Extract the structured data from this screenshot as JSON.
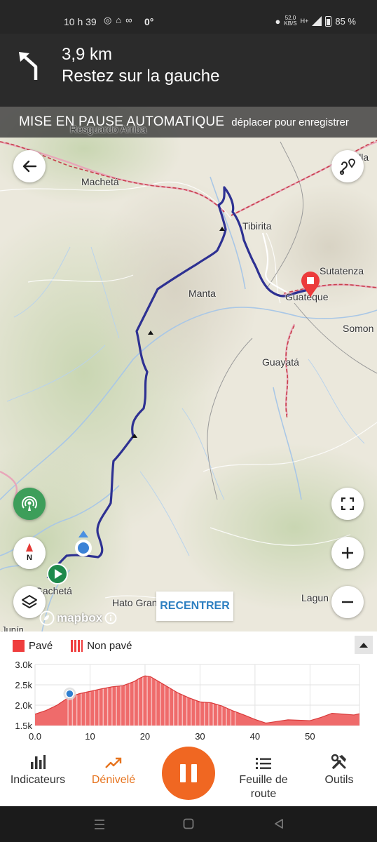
{
  "status_bar": {
    "time": "10 h 39",
    "temperature": "0°",
    "network_speed": "52,0",
    "network_unit": "KB/S",
    "network_type": "H+",
    "battery": "85 %"
  },
  "navigation": {
    "distance": "3,9 km",
    "instruction": "Restez sur la gauche",
    "icon": "turn-left-arrow-icon"
  },
  "map": {
    "pause_title": "MISE EN PAUSE AUTOMATIQUE",
    "pause_hint": "déplacer pour enregistrer",
    "labels": {
      "resguardo": "Resguardo Arriba",
      "macheta": "Machetá",
      "tibirita": "Tibirita",
      "sutatenza": "Sutatenza",
      "manta": "Manta",
      "guateque": "Guateque",
      "somon": "Somon",
      "guayata": "Guayatá",
      "gacheta": "Gachetá",
      "hato": "Hato Gran",
      "lagun": "Lagun",
      "junin": "Junín",
      "villa": "Villa"
    },
    "recenter_label": "RECENTRER",
    "mapbox_label": "mapbox",
    "compass_label": "N"
  },
  "elevation": {
    "legend_paved": "Pavé",
    "legend_unpaved": "Non pavé",
    "y_ticks": [
      "3.0k",
      "2.5k",
      "2.0k",
      "1.5k"
    ],
    "x_ticks": [
      "0.0",
      "10",
      "20",
      "30",
      "40",
      "50"
    ]
  },
  "tabs": {
    "indicators": "Indicateurs",
    "elevation": "Dénivelé",
    "route_sheet": "Feuille de route",
    "tools": "Outils"
  },
  "colors": {
    "accent": "#f06722",
    "route": "#2e3192",
    "elevation_fill": "#ef3d3d",
    "pause_banner": "#3c3c3c"
  },
  "chart_data": {
    "type": "area",
    "xlabel": "",
    "ylabel": "",
    "xlim": [
      0,
      59
    ],
    "ylim": [
      1500,
      3000
    ],
    "current_position": {
      "x": 6.3,
      "y": 2280
    },
    "x": [
      0,
      2,
      4,
      6,
      8,
      10,
      12,
      14,
      16,
      18,
      19,
      20,
      21,
      22,
      24,
      26,
      28,
      30,
      32,
      34,
      36,
      38,
      40,
      42,
      44,
      46,
      48,
      50,
      52,
      54,
      56,
      58,
      59
    ],
    "values": [
      1780,
      1870,
      2000,
      2180,
      2280,
      2340,
      2400,
      2450,
      2480,
      2580,
      2660,
      2720,
      2700,
      2620,
      2460,
      2300,
      2180,
      2080,
      2060,
      1980,
      1860,
      1760,
      1650,
      1560,
      1600,
      1640,
      1630,
      1620,
      1700,
      1800,
      1780,
      1760,
      1790
    ]
  }
}
